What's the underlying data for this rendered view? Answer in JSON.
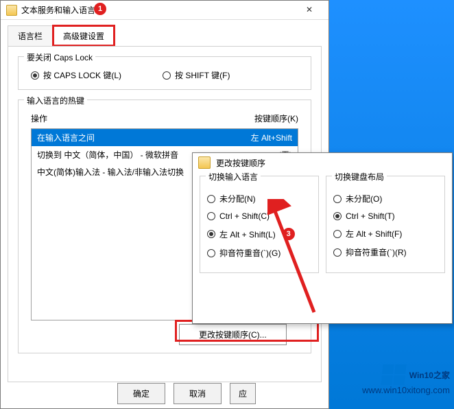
{
  "dialog": {
    "title": "文本服务和输入语言",
    "tabs": {
      "lang": "语言栏",
      "adv": "高级键设置"
    },
    "caps_group_title": "要关闭 Caps Lock",
    "caps_radio1": "按 CAPS LOCK 键(L)",
    "caps_radio2": "按 SHIFT 键(F)",
    "hotkey_group_title": "输入语言的热键",
    "col_action": "操作",
    "col_key": "按键顺序(K)",
    "rows": [
      {
        "action": "在输入语言之间",
        "key": "左 Alt+Shift"
      },
      {
        "action": "切换到 中文（简体，中国） - 微软拼音",
        "key": "(无)"
      },
      {
        "action": "中文(简体)输入法 - 输入法/非输入法切换",
        "key": ""
      }
    ],
    "change_btn": "更改按键顺序(C)...",
    "ok": "确定",
    "cancel": "取消",
    "apply": "应"
  },
  "sub": {
    "title": "更改按键顺序",
    "left_title": "切换输入语言",
    "right_title": "切换键盘布局",
    "left_opts": {
      "none": "未分配(N)",
      "cs": "Ctrl + Shift(C)",
      "as": "左 Alt + Shift(L)",
      "gr": "抑音符重音(`)(G)"
    },
    "right_opts": {
      "none": "未分配(O)",
      "cs": "Ctrl + Shift(T)",
      "as": "左 Alt + Shift(F)",
      "gr": "抑音符重音(`)(R)"
    }
  },
  "brand": {
    "name": "Win10",
    "suffix": "之家",
    "url": "www.win10xitong.com"
  },
  "badges": {
    "b1": "1",
    "b3": "3"
  }
}
